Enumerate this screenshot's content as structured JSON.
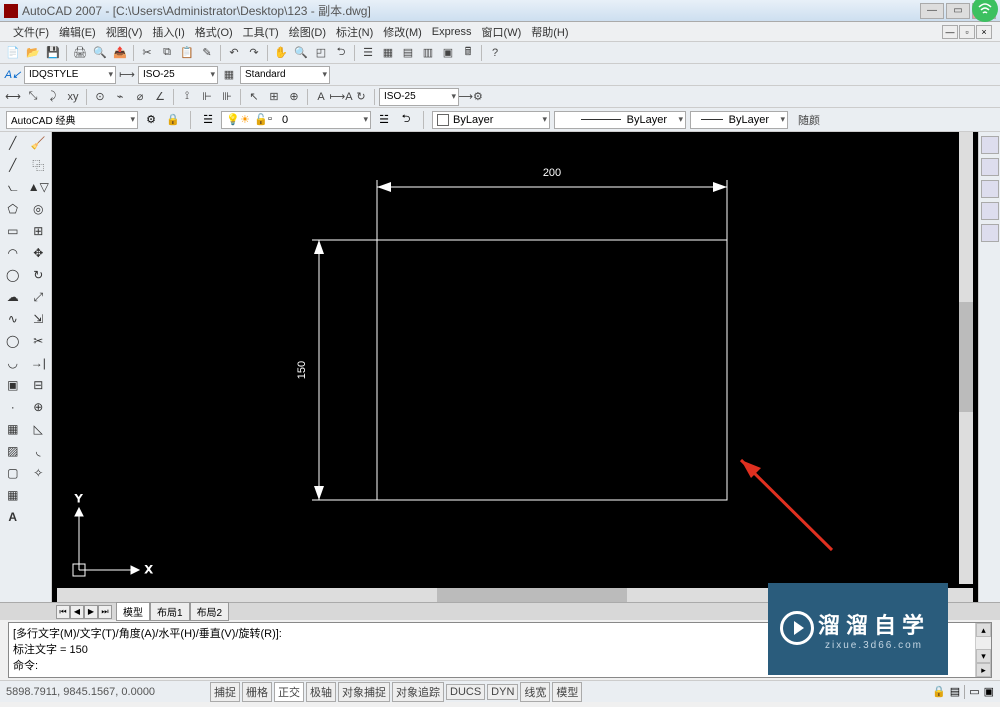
{
  "title": "AutoCAD 2007 - [C:\\Users\\Administrator\\Desktop\\123 - 副本.dwg]",
  "menus": [
    "文件(F)",
    "编辑(E)",
    "视图(V)",
    "插入(I)",
    "格式(O)",
    "工具(T)",
    "绘图(D)",
    "标注(N)",
    "修改(M)",
    "Express",
    "窗口(W)",
    "帮助(H)"
  ],
  "style_toolbar": {
    "text_style": "IDQSTYLE",
    "dim_style": "ISO-25",
    "table_style": "Standard"
  },
  "dim_toolbar": {
    "dim_style": "ISO-25"
  },
  "workspace": {
    "name": "AutoCAD 经典",
    "layer_label": "0",
    "bylayer1": "ByLayer",
    "bylayer2": "ByLayer",
    "bylayer3": "ByLayer",
    "extra": "随颜"
  },
  "drawing": {
    "width_dim": "200",
    "height_dim": "150",
    "ucs_x": "X",
    "ucs_y": "Y"
  },
  "tabs": {
    "active": "模型",
    "layouts": [
      "布局1",
      "布局2"
    ]
  },
  "command": {
    "line1": "[多行文字(M)/文字(T)/角度(A)/水平(H)/垂直(V)/旋转(R)]:",
    "line2": "标注文字 = 150",
    "line3": "命令:"
  },
  "status": {
    "coords": "5898.7911, 9845.1567, 0.0000",
    "modes": [
      "捕捉",
      "栅格",
      "正交",
      "极轴",
      "对象捕捉",
      "对象追踪",
      "DUCS",
      "DYN",
      "线宽",
      "模型"
    ]
  },
  "watermark": {
    "brand": "溜溜自学",
    "url": "zixue.3d66.com"
  }
}
